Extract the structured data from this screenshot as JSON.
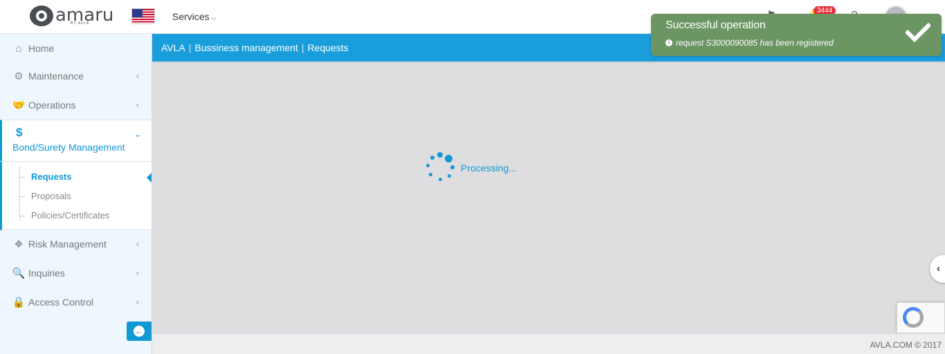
{
  "header": {
    "logo_text": "amaru",
    "logo_sub": "BY AVLA",
    "services_label": "Services",
    "notification_count": "3444"
  },
  "sidebar": {
    "items": [
      {
        "label": "Home",
        "icon": "home-icon"
      },
      {
        "label": "Maintenance",
        "icon": "gear-icon"
      },
      {
        "label": "Operations",
        "icon": "handshake-icon"
      },
      {
        "label": "Bond/Surety Management",
        "icon": "dollar-icon"
      },
      {
        "label": "Risk Management",
        "icon": "cubes-icon"
      },
      {
        "label": "Inquiries",
        "icon": "search-icon"
      },
      {
        "label": "Access Control",
        "icon": "lock-icon"
      }
    ],
    "sub_items": [
      {
        "label": "Requests",
        "active": true
      },
      {
        "label": "Proposals"
      },
      {
        "label": "Policies/Certificates"
      }
    ]
  },
  "breadcrumb": {
    "parts": [
      "AVLA",
      "Bussiness management",
      "Requests"
    ],
    "separator": "|"
  },
  "main": {
    "processing_text": "Processing..."
  },
  "footer": {
    "copyright": "AVLA.COM © 2017"
  },
  "toast": {
    "title": "Successful operation",
    "message": "request S3000090085 has been registered"
  },
  "colors": {
    "accent": "#1a9edb",
    "toast_bg": "#6c9564",
    "badge": "#e8323c",
    "content_bg": "#dedde0"
  }
}
